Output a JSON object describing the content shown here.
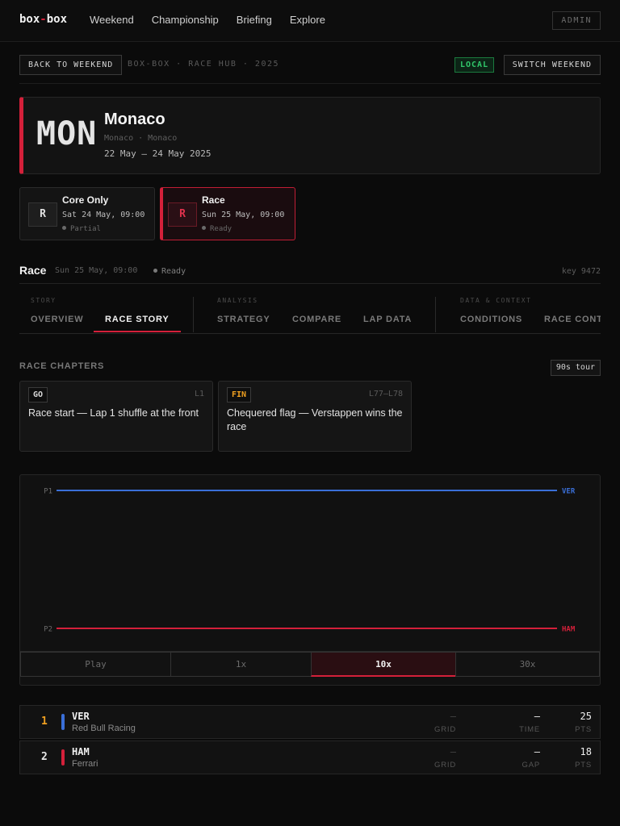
{
  "nav": {
    "brand_left": "box",
    "brand_sep": "-",
    "brand_right": "box",
    "links": [
      "Weekend",
      "Championship",
      "Briefing",
      "Explore"
    ],
    "admin_label": "ADMIN"
  },
  "context": {
    "back_label": "BACK TO WEEKEND",
    "breadcrumb": "BOX-BOX · RACE HUB · 2025",
    "local_label": "LOCAL",
    "switch_label": "SWITCH WEEKEND"
  },
  "weekend": {
    "code": "MON",
    "name": "Monaco",
    "location": "Monaco · Monaco",
    "dates": "22 May – 24 May 2025",
    "accent": "#d4203a"
  },
  "sessions": [
    {
      "badge": "R",
      "name": "Core Only",
      "time": "Sat 24 May, 09:00",
      "status": "Partial",
      "active": false
    },
    {
      "badge": "R",
      "name": "Race",
      "time": "Sun 25 May, 09:00",
      "status": "Ready",
      "active": true
    }
  ],
  "session_header": {
    "title": "Race",
    "time": "Sun 25 May, 09:00",
    "status": "Ready",
    "key": "key 9472"
  },
  "tabs": {
    "groups": [
      {
        "label": "STORY",
        "tabs": [
          "OVERVIEW",
          "RACE STORY"
        ]
      },
      {
        "label": "ANALYSIS",
        "tabs": [
          "STRATEGY",
          "COMPARE",
          "LAP DATA"
        ]
      },
      {
        "label": "DATA & CONTEXT",
        "tabs": [
          "CONDITIONS",
          "RACE CONT"
        ]
      }
    ],
    "active": "RACE STORY"
  },
  "chapters": {
    "heading": "RACE CHAPTERS",
    "tour_label": "90s tour",
    "items": [
      {
        "tag": "GO",
        "lap": "L1",
        "text": "Race start — Lap 1 shuffle at the front"
      },
      {
        "tag": "FIN",
        "lap": "L77–L78",
        "text": "Chequered flag — Verstappen wins the race"
      }
    ]
  },
  "chart_data": {
    "type": "line",
    "y_categories": [
      "P1",
      "P2"
    ],
    "series": [
      {
        "name": "VER",
        "position": 1,
        "color": "#3a6fd8"
      },
      {
        "name": "HAM",
        "position": 2,
        "color": "#d4203a"
      }
    ]
  },
  "playback": {
    "play_label": "Play",
    "speeds": [
      "1x",
      "10x",
      "30x"
    ],
    "active_speed": "10x"
  },
  "results": [
    {
      "pos": "1",
      "code": "VER",
      "team": "Red Bull Racing",
      "color": "#3a6fd8",
      "pos_color": "#f0a020",
      "grid": "–",
      "grid_label": "GRID",
      "time": "—",
      "time_label": "TIME",
      "pts": "25",
      "pts_label": "PTS"
    },
    {
      "pos": "2",
      "code": "HAM",
      "team": "Ferrari",
      "color": "#d4203a",
      "pos_color": "#e6e6e6",
      "grid": "–",
      "grid_label": "GRID",
      "time": "—",
      "time_label": "GAP",
      "pts": "18",
      "pts_label": "PTS"
    }
  ]
}
